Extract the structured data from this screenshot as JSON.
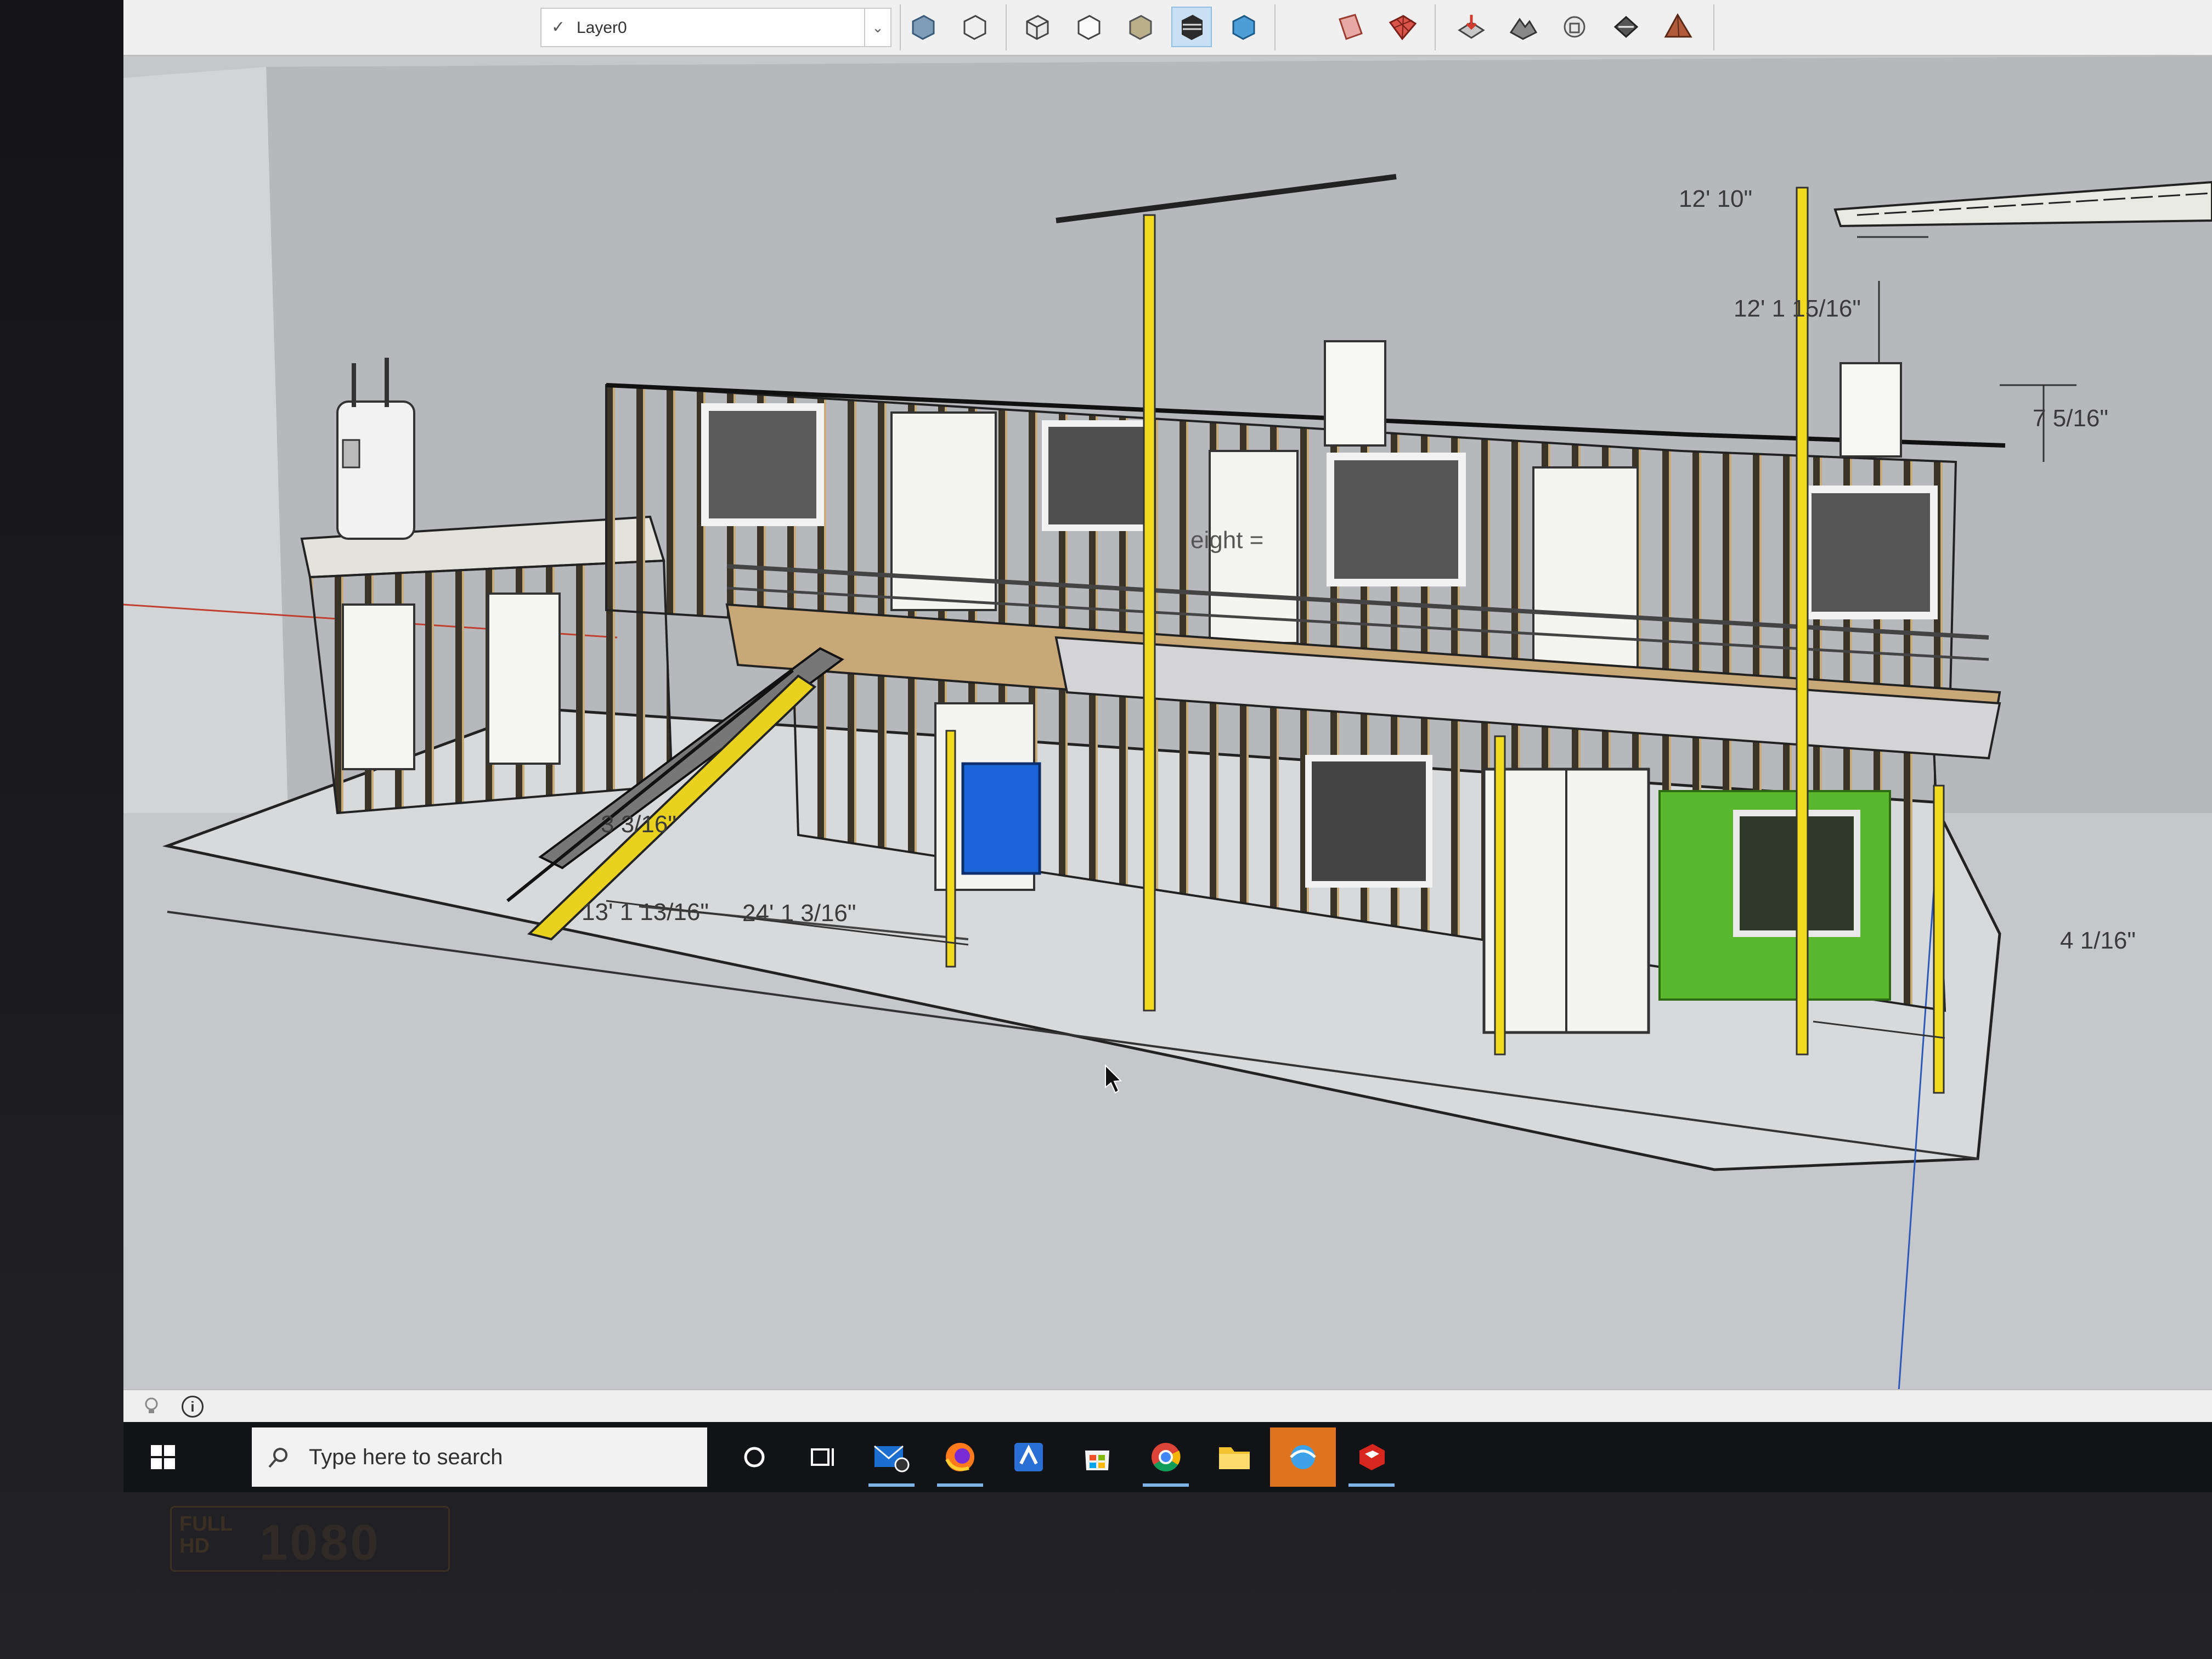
{
  "toolbar": {
    "layer": {
      "checked": true,
      "name": "Layer0"
    },
    "tools": [
      {
        "icon": "box-style-icon"
      },
      {
        "icon": "wireframe-icon"
      },
      {
        "icon": "xray-icon"
      },
      {
        "icon": "back-edges-icon"
      },
      {
        "icon": "shaded-icon"
      },
      {
        "icon": "shaded-textures-icon"
      },
      {
        "icon": "monochrome-icon"
      },
      {
        "icon": "section-plane-icon"
      },
      {
        "icon": "grid-icon"
      },
      {
        "icon": "sandbox-drape-icon"
      },
      {
        "icon": "terrain-icon"
      },
      {
        "icon": "extension-icon"
      },
      {
        "icon": "flip-icon"
      },
      {
        "icon": "pyramid-icon"
      }
    ]
  },
  "dimensions": {
    "top_right_1": "12' 10\"",
    "top_right_2": "12' 1 15/16\"",
    "right_1": "7 5/16\"",
    "right_2": "4 1/16\"",
    "left_1": "3 3/16\"",
    "left_2": "13' 1 13/16\"",
    "left_3": "24' 1 3/16\"",
    "center_tag": "eight ="
  },
  "statusbar": {
    "info_icon": "info-icon",
    "hint_icon": "lightbulb-icon"
  },
  "taskbar": {
    "search_placeholder": "Type here to search",
    "apps": [
      {
        "icon": "cortana-icon"
      },
      {
        "icon": "task-view-icon"
      },
      {
        "icon": "mail-icon"
      },
      {
        "icon": "firefox-icon"
      },
      {
        "icon": "app-icon"
      },
      {
        "icon": "store-icon"
      },
      {
        "icon": "chrome-icon"
      },
      {
        "icon": "file-explorer-icon"
      },
      {
        "icon": "browser-icon"
      },
      {
        "icon": "sketchup-icon"
      }
    ]
  },
  "monitor": {
    "badge_top": "FULL",
    "badge_bottom": "HD",
    "resolution": "1080"
  }
}
